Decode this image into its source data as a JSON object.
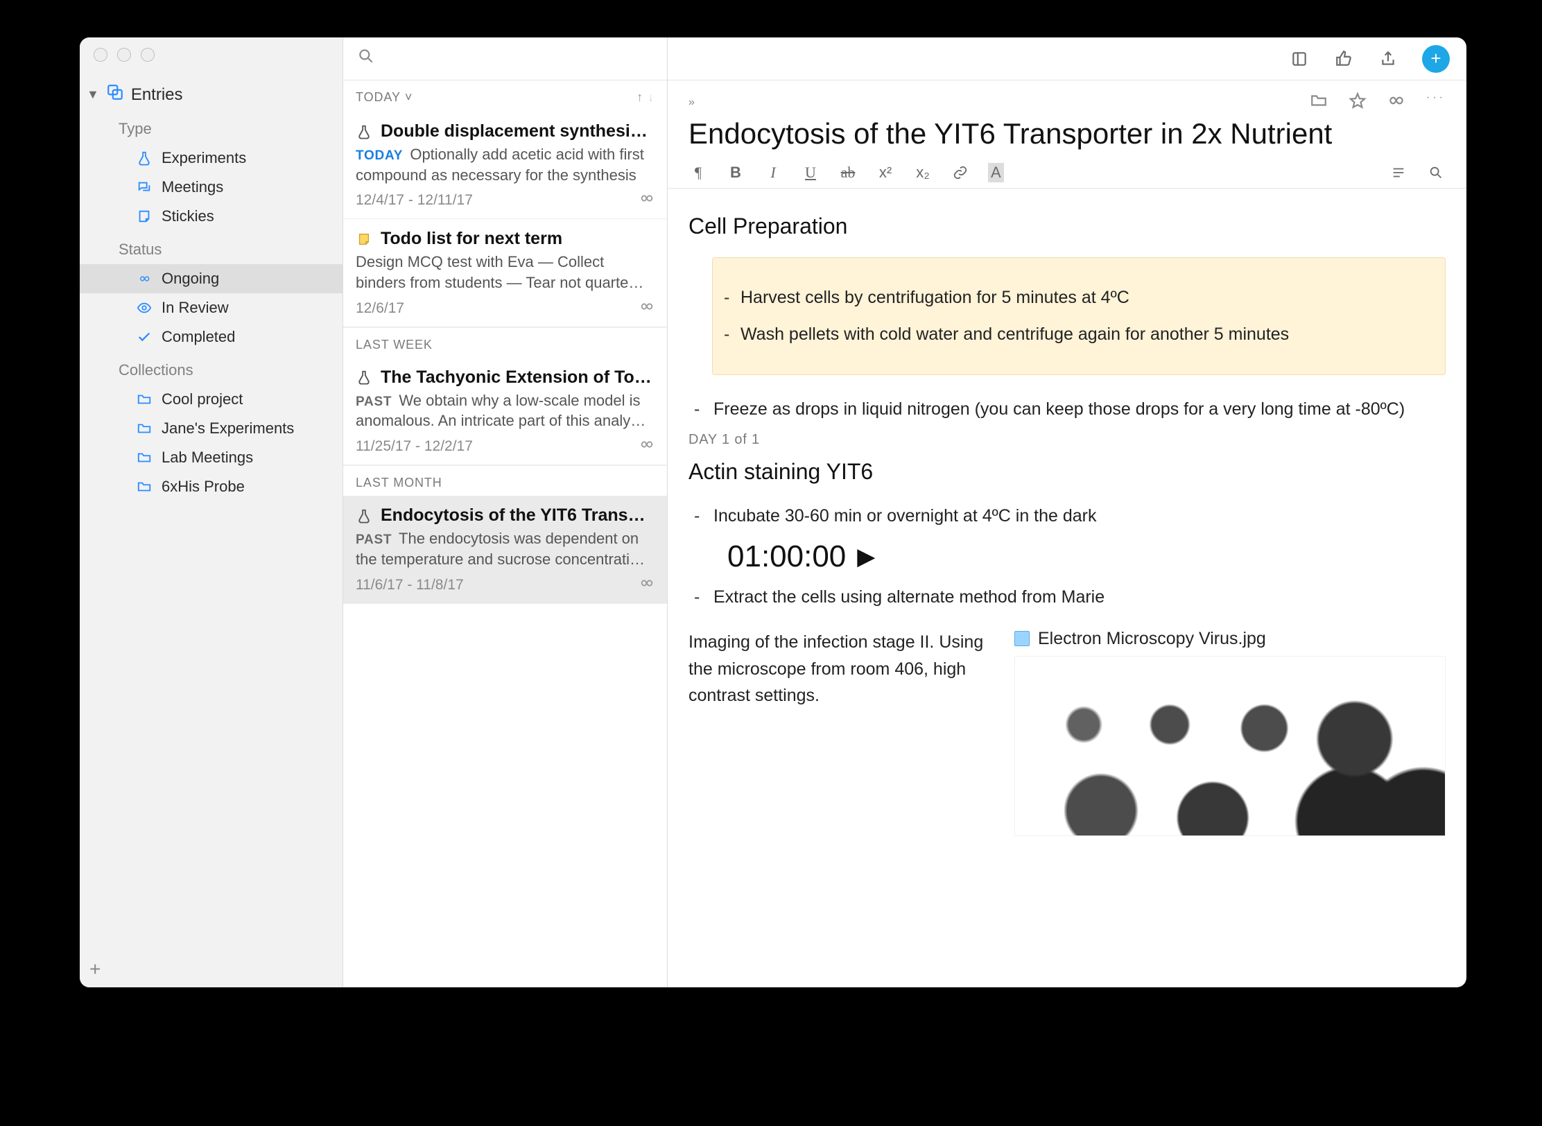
{
  "sidebar": {
    "root": "Entries",
    "sections": {
      "type": {
        "label": "Type",
        "items": [
          {
            "label": "Experiments",
            "icon": "flask"
          },
          {
            "label": "Meetings",
            "icon": "chat"
          },
          {
            "label": "Stickies",
            "icon": "sticky"
          }
        ]
      },
      "status": {
        "label": "Status",
        "items": [
          {
            "label": "Ongoing",
            "icon": "infinity",
            "selected": true
          },
          {
            "label": "In Review",
            "icon": "eye"
          },
          {
            "label": "Completed",
            "icon": "check"
          }
        ]
      },
      "collections": {
        "label": "Collections",
        "items": [
          {
            "label": "Cool project"
          },
          {
            "label": "Jane's Experiments"
          },
          {
            "label": "Lab Meetings"
          },
          {
            "label": "6xHis Probe"
          }
        ]
      }
    }
  },
  "list": {
    "header": {
      "label": "TODAY"
    },
    "groups": [
      {
        "label": null,
        "entries": [
          {
            "icon": "flask",
            "title": "Double displacement synthesi…",
            "tag": "TODAY",
            "desc": "Optionally add acetic acid with first compound as necessary for the synthesis",
            "date": "12/4/17 - 12/11/17",
            "status_icon": "infinity"
          },
          {
            "icon": "sticky",
            "title": "Todo list for next term",
            "tag": "",
            "desc": "Design MCQ test with Eva — Collect binders from students — Tear not quarte…",
            "date": "12/6/17",
            "status_icon": "infinity"
          }
        ]
      },
      {
        "label": "LAST WEEK",
        "entries": [
          {
            "icon": "flask",
            "title": "The Tachyonic Extension of To…",
            "tag": "PAST",
            "desc": "We obtain why a low-scale model is anomalous. An intricate part of this analy…",
            "date": "11/25/17 - 12/2/17",
            "status_icon": "infinity"
          }
        ]
      },
      {
        "label": "LAST MONTH",
        "entries": [
          {
            "icon": "flask",
            "title": "Endocytosis of the YIT6 Trans…",
            "tag": "PAST",
            "desc": "The endocytosis was dependent on the temperature and sucrose concentrati…",
            "date": "11/6/17 - 11/8/17",
            "status_icon": "infinity",
            "selected": true
          }
        ]
      }
    ]
  },
  "note": {
    "title": "Endocytosis of the YIT6 Transporter in 2x Nutrient",
    "section1": "Cell Preparation",
    "callout": {
      "items": [
        "Harvest cells by centrifugation for 5 minutes at 4ºC",
        "Wash pellets with cold water and centrifuge again for another 5 minutes"
      ]
    },
    "bullets1": [
      "Freeze as drops in liquid nitrogen (you can keep those drops for a very long time at -80ºC)"
    ],
    "day_label": "DAY 1 of 1",
    "section2": "Actin staining YIT6",
    "bullets2": [
      "Incubate 30-60 min or overnight at 4ºC in the dark"
    ],
    "timer": "01:00:00",
    "bullets3": [
      "Extract the cells using alternate method from Marie"
    ],
    "media_text": "Imaging of the infection stage II. Using the microscope from room 406, high contrast settings.",
    "attachment_name": "Electron Microscopy Virus.jpg",
    "format_bar": {
      "paragraph": "¶",
      "bold": "B",
      "italic": "I",
      "underline": "U",
      "strike": "ab",
      "sup": "x²",
      "sub": "x₂",
      "link": "⚙",
      "highlight": "A"
    }
  }
}
